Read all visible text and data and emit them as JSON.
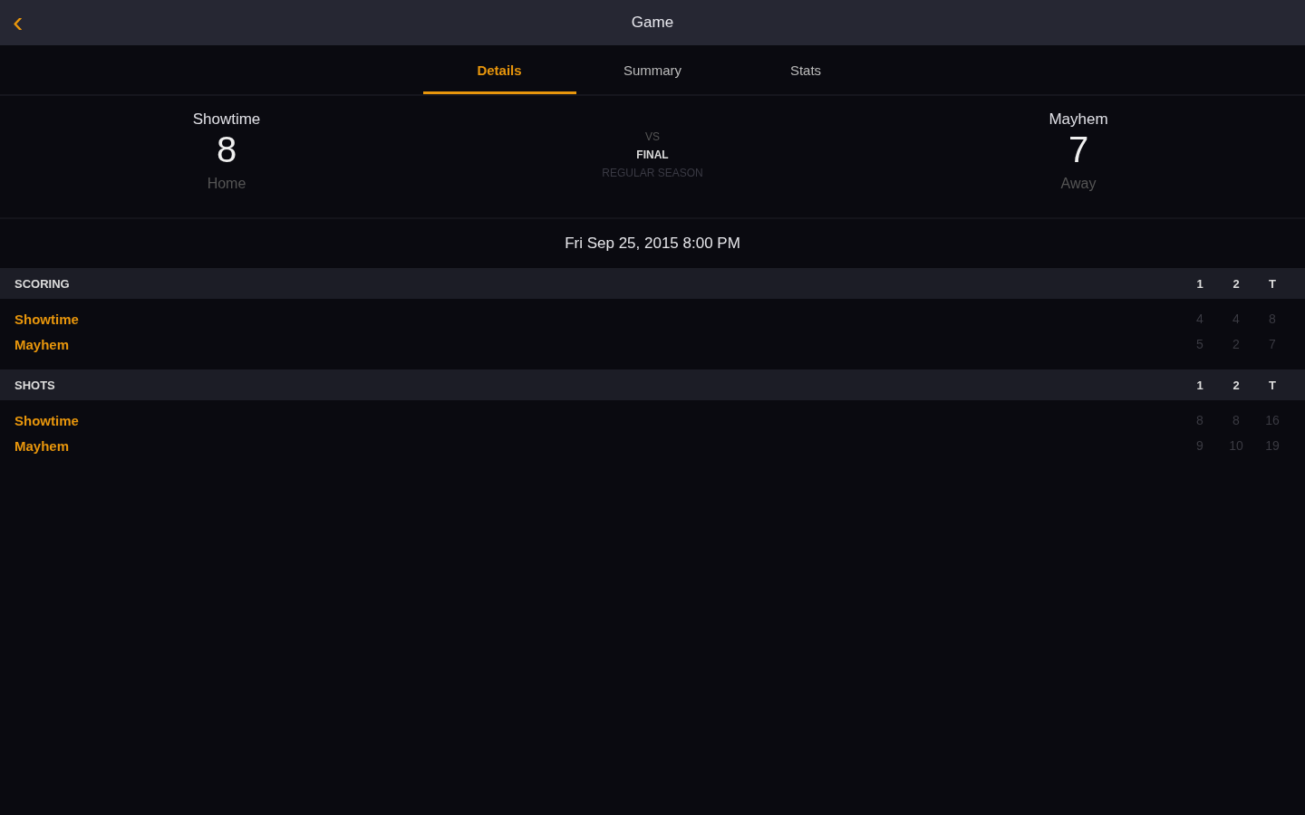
{
  "top_bar": {
    "back": "‹",
    "title": "Game"
  },
  "tabs": [
    {
      "label": "Details",
      "selected": true
    },
    {
      "label": "Summary",
      "selected": false
    },
    {
      "label": "Stats",
      "selected": false
    }
  ],
  "matchup": {
    "home": {
      "name": "Showtime",
      "score": "8",
      "side": "Home"
    },
    "vs": "VS",
    "status": "FINAL",
    "season": "REGULAR SEASON",
    "away": {
      "name": "Mayhem",
      "score": "7",
      "side": "Away"
    }
  },
  "date": "Fri Sep 25, 2015 8:00 PM",
  "sections": [
    {
      "title": "SCORING",
      "columns": [
        "1",
        "2",
        "T"
      ],
      "rows": [
        {
          "team": "Showtime",
          "values": [
            "4",
            "4",
            "8"
          ]
        },
        {
          "team": "Mayhem",
          "values": [
            "5",
            "2",
            "7"
          ]
        }
      ]
    },
    {
      "title": "SHOTS",
      "columns": [
        "1",
        "2",
        "T"
      ],
      "rows": [
        {
          "team": "Showtime",
          "values": [
            "8",
            "8",
            "16"
          ]
        },
        {
          "team": "Mayhem",
          "values": [
            "9",
            "10",
            "19"
          ]
        }
      ]
    }
  ]
}
